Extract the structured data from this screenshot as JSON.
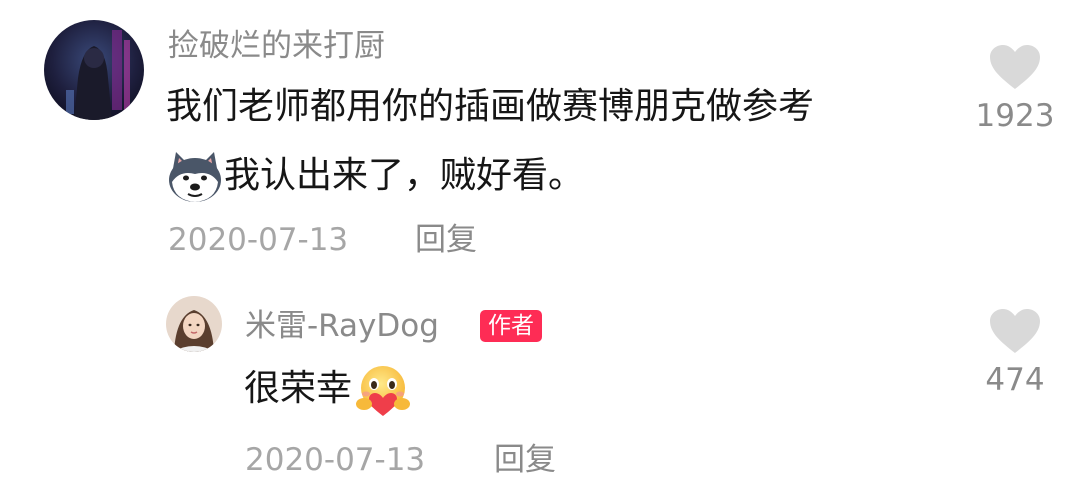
{
  "comment": {
    "username": "捡破烂的来打厨",
    "line1": "我们老师都用你的插画做赛博朋克做参考",
    "line2": "我认出来了，贼好看。",
    "line2_emoji": "husky-emoji-icon",
    "date": "2020-07-13",
    "reply_label": "回复",
    "like_icon": "heart-icon",
    "like_count": "1923"
  },
  "reply_comment": {
    "username": "米雷-RayDog",
    "badge": "作者",
    "text": "很荣幸",
    "text_emoji": "hug-heart-emoji-icon",
    "date": "2020-07-13",
    "reply_label": "回复",
    "like_icon": "heart-icon",
    "like_count": "474"
  },
  "colors": {
    "badge": "#fe2c55",
    "username": "#8a8a8a",
    "text": "#161616",
    "heart": "#d9d9d9"
  }
}
